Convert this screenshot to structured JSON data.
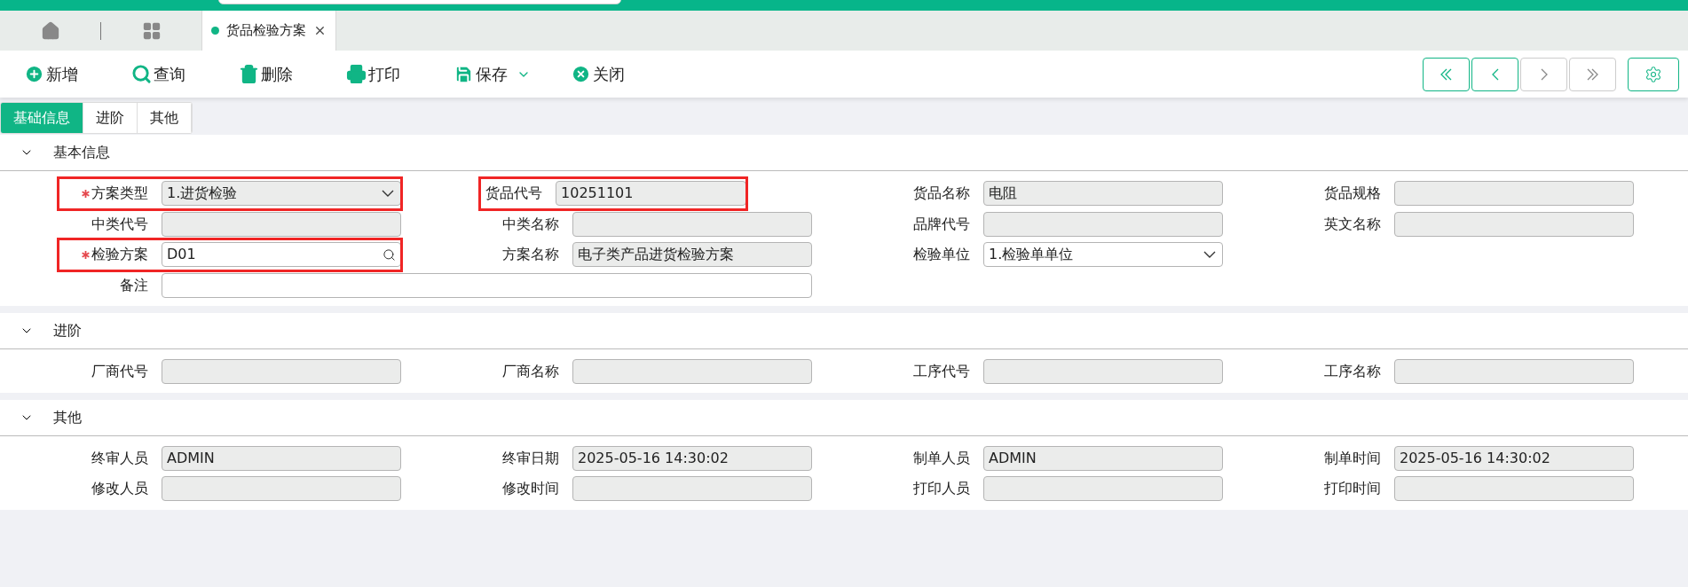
{
  "window_tabs": [
    {
      "kind": "home",
      "selected": false
    },
    {
      "kind": "apps",
      "selected": false
    },
    {
      "kind": "page",
      "label": "货品检验方案",
      "selected": true
    }
  ],
  "toolbar": [
    {
      "kind": "add",
      "label": "新增"
    },
    {
      "kind": "search",
      "label": "查询"
    },
    {
      "kind": "delete",
      "label": "删除"
    },
    {
      "kind": "print",
      "label": "打印"
    },
    {
      "kind": "save",
      "label": "保存"
    },
    {
      "kind": "close",
      "label": "关闭"
    }
  ],
  "nav_buttons": [
    {
      "kind": "first",
      "disabled": false
    },
    {
      "kind": "prev",
      "disabled": false
    },
    {
      "kind": "next",
      "disabled": true
    },
    {
      "kind": "last",
      "disabled": true
    },
    {
      "kind": "settings",
      "disabled": false
    }
  ],
  "sub_tabs": [
    {
      "label": "基础信息",
      "selected": true
    },
    {
      "label": "进阶",
      "selected": false
    },
    {
      "label": "其他",
      "selected": false
    }
  ],
  "sections": [
    {
      "title": "基本信息",
      "expanded": true,
      "fields": [
        {
          "label": "方案类型",
          "value": "1.进货检验",
          "kind": "select",
          "required": true,
          "disabled": true,
          "highlighted": true
        },
        {
          "label": "货品代号",
          "value": "10251101",
          "kind": "text",
          "required": false,
          "disabled": true,
          "highlighted": true
        },
        {
          "label": "货品名称",
          "value": "电阻",
          "kind": "text",
          "required": false,
          "disabled": true,
          "highlighted": false
        },
        {
          "label": "货品规格",
          "kind": "text",
          "required": false,
          "disabled": true,
          "highlighted": false
        },
        {
          "label": "中类代号",
          "kind": "text",
          "required": false,
          "disabled": true,
          "highlighted": false
        },
        {
          "label": "中类名称",
          "kind": "text",
          "required": false,
          "disabled": true,
          "highlighted": false
        },
        {
          "label": "品牌代号",
          "kind": "text",
          "required": false,
          "disabled": true,
          "highlighted": false
        },
        {
          "label": "英文名称",
          "kind": "text",
          "required": false,
          "disabled": true,
          "highlighted": false
        },
        {
          "label": "检验方案",
          "value": "D01",
          "kind": "lookup",
          "required": true,
          "disabled": false,
          "highlighted": true
        },
        {
          "label": "方案名称",
          "value": "电子类产品进货检验方案",
          "kind": "text",
          "required": false,
          "disabled": true,
          "highlighted": false
        },
        {
          "label": "检验单位",
          "value": "1.检验单单位",
          "kind": "select",
          "required": false,
          "disabled": false,
          "highlighted": false
        },
        {
          "kind": "spacer"
        },
        {
          "label": "备注",
          "kind": "wide",
          "required": false,
          "disabled": false,
          "highlighted": false
        }
      ]
    },
    {
      "title": "进阶",
      "expanded": true,
      "fields": [
        {
          "label": "厂商代号",
          "kind": "text",
          "required": false,
          "disabled": true,
          "highlighted": false
        },
        {
          "label": "厂商名称",
          "kind": "text",
          "required": false,
          "disabled": true,
          "highlighted": false
        },
        {
          "label": "工序代号",
          "kind": "text",
          "required": false,
          "disabled": true,
          "highlighted": false
        },
        {
          "label": "工序名称",
          "kind": "text",
          "required": false,
          "disabled": true,
          "highlighted": false
        }
      ]
    },
    {
      "title": "其他",
      "expanded": true,
      "fields": [
        {
          "label": "终审人员",
          "value": "ADMIN",
          "kind": "text",
          "required": false,
          "disabled": true,
          "highlighted": false
        },
        {
          "label": "终审日期",
          "value": "2025-05-16 14:30:02",
          "kind": "text",
          "required": false,
          "disabled": true,
          "highlighted": false
        },
        {
          "label": "制单人员",
          "value": "ADMIN",
          "kind": "text",
          "required": false,
          "disabled": true,
          "highlighted": false
        },
        {
          "label": "制单时间",
          "value": "2025-05-16 14:30:02",
          "kind": "text",
          "required": false,
          "disabled": true,
          "highlighted": false
        },
        {
          "label": "修改人员",
          "kind": "text",
          "required": false,
          "disabled": true,
          "highlighted": false
        },
        {
          "label": "修改时间",
          "kind": "text",
          "required": false,
          "disabled": true,
          "highlighted": false
        },
        {
          "label": "打印人员",
          "kind": "text",
          "required": false,
          "disabled": true,
          "highlighted": false
        },
        {
          "label": "打印时间",
          "kind": "text",
          "required": false,
          "disabled": true,
          "highlighted": false
        }
      ]
    }
  ]
}
